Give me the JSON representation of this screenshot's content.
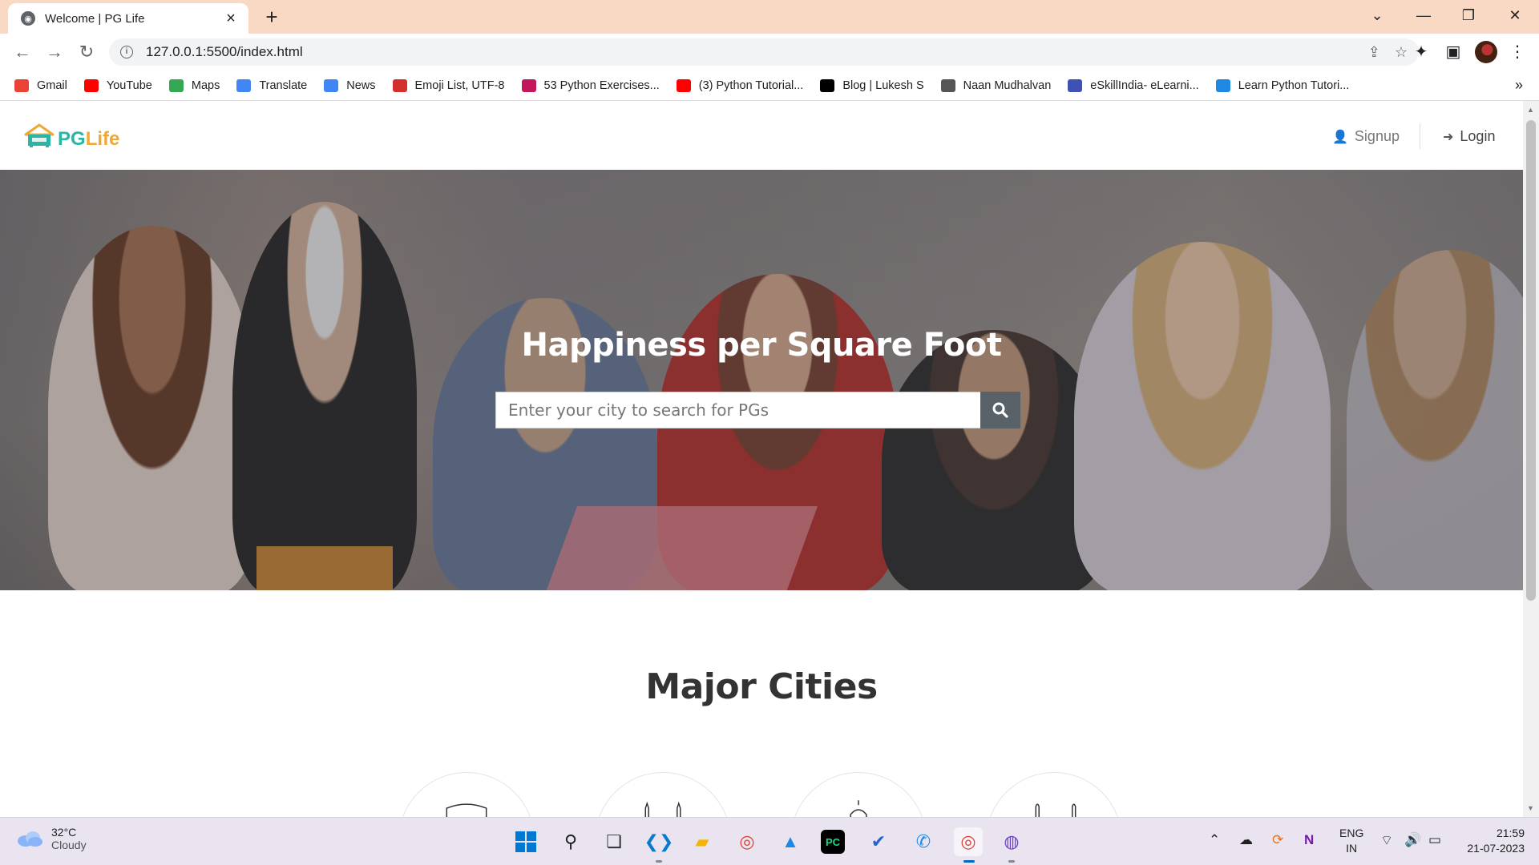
{
  "browser": {
    "tab_title": "Welcome | PG Life",
    "url": "127.0.0.1:5500/index.html",
    "bookmarks": [
      {
        "label": "Gmail",
        "icon": "gmail-icon",
        "color": "#ea4335"
      },
      {
        "label": "YouTube",
        "icon": "youtube-icon",
        "color": "#ff0000"
      },
      {
        "label": "Maps",
        "icon": "maps-icon",
        "color": "#34a853"
      },
      {
        "label": "Translate",
        "icon": "translate-icon",
        "color": "#4285f4"
      },
      {
        "label": "News",
        "icon": "news-icon",
        "color": "#4285f4"
      },
      {
        "label": "Emoji List, UTF-8",
        "icon": "unicode-icon",
        "color": "#d32f2f"
      },
      {
        "label": "53 Python Exercises...",
        "icon": "gem-icon",
        "color": "#c2185b"
      },
      {
        "label": "(3) Python Tutorial...",
        "icon": "youtube-icon",
        "color": "#ff0000"
      },
      {
        "label": "Blog | Lukesh S",
        "icon": "wix-icon",
        "color": "#000000"
      },
      {
        "label": "Naan Mudhalvan",
        "icon": "emblem-icon",
        "color": "#555555"
      },
      {
        "label": "eSkillIndia- eLearni...",
        "icon": "eskill-icon",
        "color": "#3f51b5"
      },
      {
        "label": "Learn Python Tutori...",
        "icon": "k-icon",
        "color": "#1e88e5"
      }
    ]
  },
  "site": {
    "logo_pg": "PG",
    "logo_life": "Life",
    "nav": {
      "signup": "Signup",
      "login": "Login"
    },
    "hero": {
      "title": "Happiness per Square Foot",
      "search_placeholder": "Enter your city to search for PGs"
    },
    "cities_title": "Major Cities"
  },
  "taskbar": {
    "temperature": "32°C",
    "condition": "Cloudy",
    "lang_line1": "ENG",
    "lang_line2": "IN",
    "time": "21:59",
    "date": "21-07-2023"
  },
  "colors": {
    "brand_teal": "#2bb5a6",
    "brand_orange": "#f0a734",
    "tab_bar": "#f9d9c4"
  }
}
